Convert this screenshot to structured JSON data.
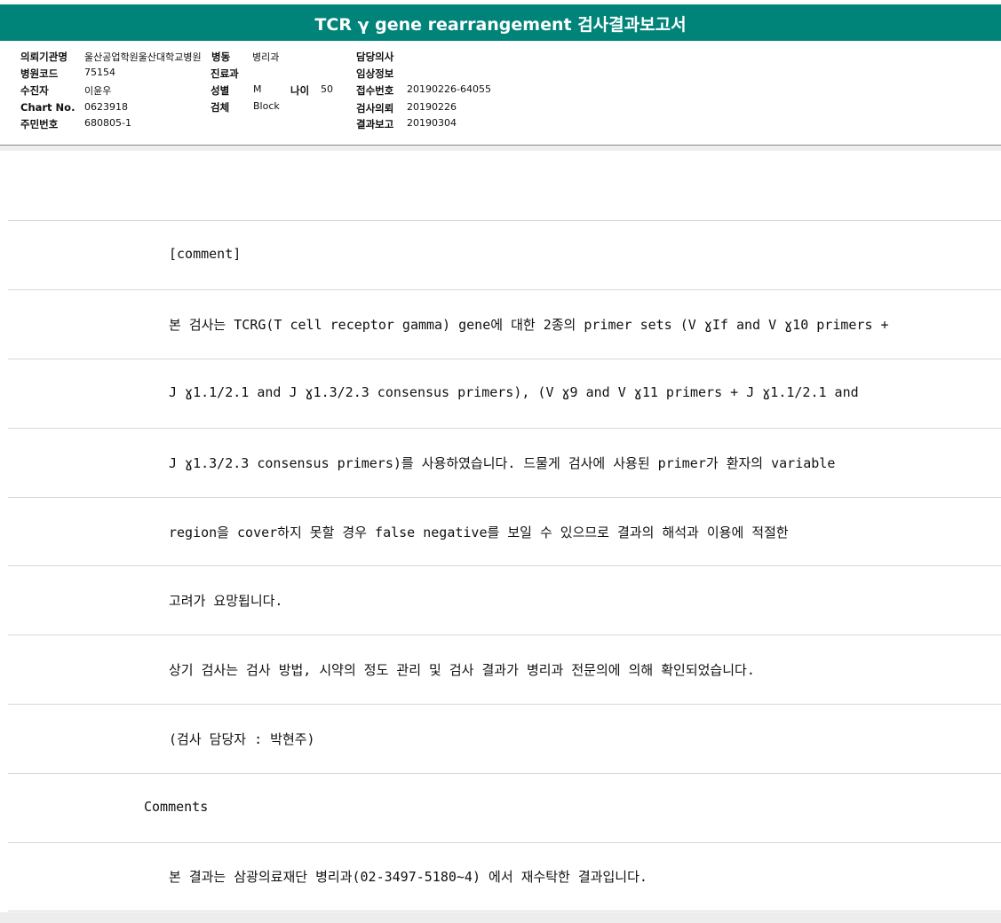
{
  "title": "TCR γ gene rearrangement 검사결과보고서",
  "header": {
    "institution_label": "의뢰기관명",
    "institution_value": "울산공업학원울산대학교병원",
    "ward_label": "병동",
    "ward_value": "병리과",
    "doctor_label": "담당의사",
    "doctor_value": "",
    "hospital_code_label": "병원코드",
    "hospital_code_value": "75154",
    "department_label": "진료과",
    "department_value": "",
    "clinical_info_label": "임상정보",
    "clinical_info_value": "",
    "patient_label": "수진자",
    "patient_value": "이윤우",
    "sex_label": "성별",
    "sex_value": "M",
    "age_label": "나이",
    "age_value": "50",
    "receipt_label": "접수번호",
    "receipt_value": "20190226-64055",
    "chart_label": "Chart No.",
    "chart_value": "0623918",
    "specimen_label": "검체",
    "specimen_value": "Block",
    "request_label": "검사의뢰",
    "request_value": "20190226",
    "id_label": "주민번호",
    "id_value": "680805-1",
    "report_label": "결과보고",
    "report_value": "20190304"
  },
  "body_lines": [
    "",
    "[comment]",
    "본 검사는 TCRG(T cell receptor gamma) gene에 대한 2종의 primer sets (V ɣIf and V ɣ10 primers +",
    "J ɣ1.1/2.1 and J ɣ1.3/2.3 consensus primers), (V ɣ9 and V ɣ11 primers + J ɣ1.1/2.1 and",
    "J ɣ1.3/2.3 consensus primers)를 사용하였습니다. 드물게 검사에 사용된 primer가 환자의 variable",
    "region을 cover하지 못할 경우 false negative를 보일 수 있으므로 결과의 해석과 이용에 적절한",
    "고려가 요망됩니다.",
    "상기 검사는 검사 방법, 시약의 정도 관리 및 검사 결과가 병리과 전문의에 의해 확인되었습니다.",
    "(검사 담당자 : 박현주)",
    "Comments",
    "본 결과는 삼광의료재단 병리과(02-3497-5180~4) 에서 재수탁한 결과입니다."
  ]
}
